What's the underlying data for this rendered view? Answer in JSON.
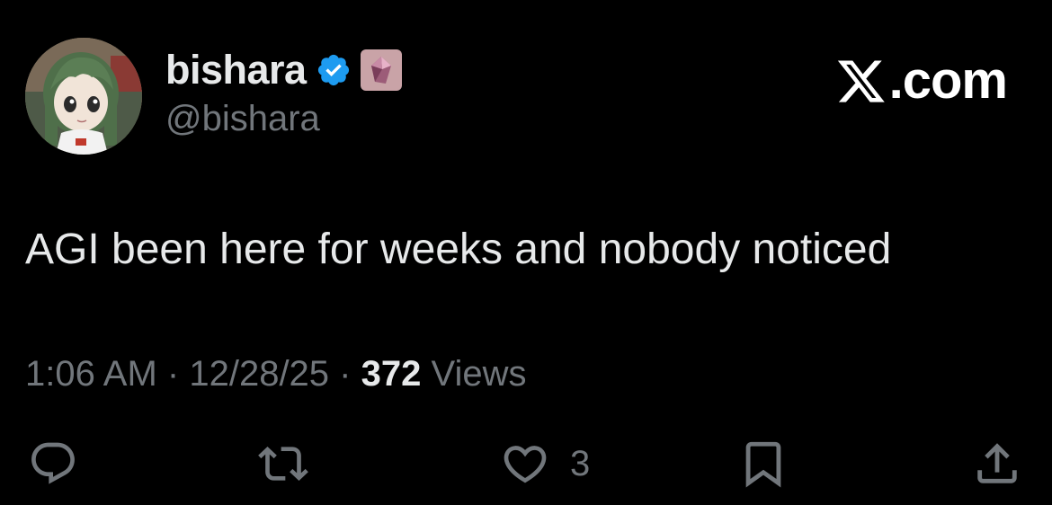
{
  "author": {
    "display_name": "bishara",
    "handle": "@bishara",
    "verified": true,
    "verified_color": "#1d9bf0",
    "affiliate_badge_icon": "pink-crystal-icon",
    "avatar_icon": "anime-character-avatar"
  },
  "brand": {
    "label": ".com",
    "logo_icon": "x-logo-icon"
  },
  "tweet": {
    "text": "AGI been here for weeks and nobody noticed",
    "time": "1:06 AM",
    "separator": "·",
    "date": "12/28/25",
    "views_count": "372",
    "views_label": "Views"
  },
  "actions": {
    "reply_icon": "reply-icon",
    "repost_icon": "repost-icon",
    "like_icon": "heart-icon",
    "like_count": "3",
    "bookmark_icon": "bookmark-icon",
    "share_icon": "share-icon"
  },
  "colors": {
    "background": "#000000",
    "primary_text": "#e7e9ea",
    "secondary_text": "#71767b",
    "verified_blue": "#1d9bf0"
  }
}
